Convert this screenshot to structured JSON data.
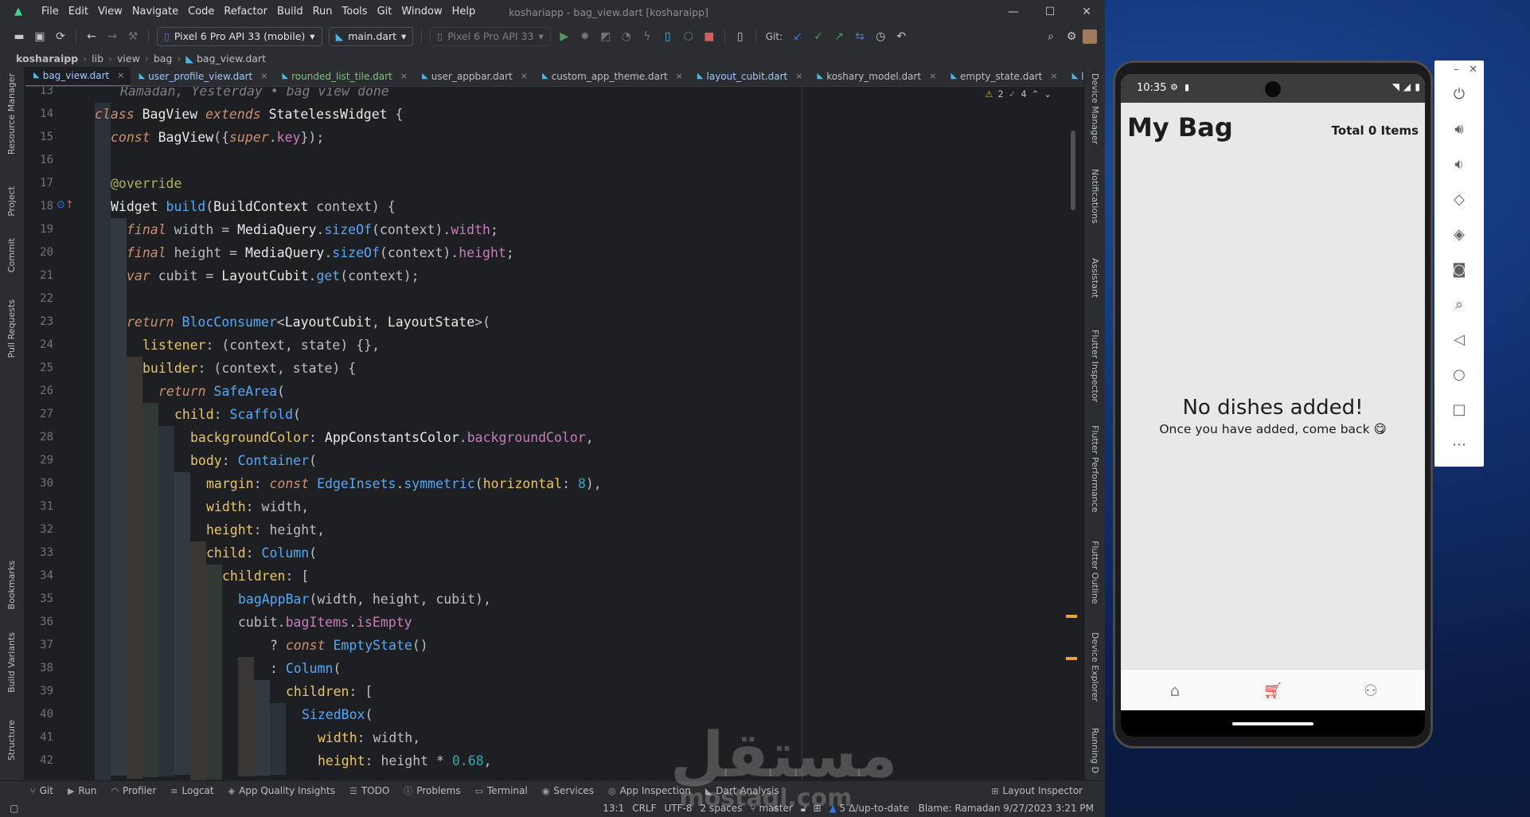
{
  "ide": {
    "menu": [
      "File",
      "Edit",
      "View",
      "Navigate",
      "Code",
      "Refactor",
      "Build",
      "Run",
      "Tools",
      "Git",
      "Window",
      "Help"
    ],
    "window_title": "koshariapp - bag_view.dart [kosharaipp]",
    "device_combo": "Pixel 6 Pro API 33 (mobile)",
    "run_config": "main.dart",
    "emulator_combo": "Pixel 6 Pro API 33",
    "git_label": "Git:",
    "breadcrumb": [
      "kosharaipp",
      "lib",
      "view",
      "bag",
      "bag_view.dart"
    ],
    "tabs": [
      "bag_view.dart",
      "user_profile_view.dart",
      "rounded_list_tile.dart",
      "user_appbar.dart",
      "custom_app_theme.dart",
      "layout_cubit.dart",
      "koshary_model.dart",
      "empty_state.dart",
      "layout_sta"
    ],
    "inspection_warnings": "2",
    "inspection_weak": "4",
    "left_tools": [
      "Resource Manager",
      "Project",
      "Commit",
      "Pull Requests",
      "Bookmarks",
      "Build Variants",
      "Structure"
    ],
    "right_tools": [
      "Device Manager",
      "Notifications",
      "Assistant",
      "Flutter Inspector",
      "Flutter Performance",
      "Flutter Outline",
      "Device Explorer",
      "Running D"
    ],
    "blame_line": "Ramadan, Yesterday • bag view done",
    "line_numbers": [
      "13",
      "14",
      "15",
      "16",
      "17",
      "18",
      "19",
      "20",
      "21",
      "22",
      "23",
      "24",
      "25",
      "26",
      "27",
      "28",
      "29",
      "30",
      "31",
      "32",
      "33",
      "34",
      "35",
      "36",
      "37",
      "38",
      "39",
      "40",
      "41",
      "42"
    ],
    "tool_windows": [
      "Git",
      "Run",
      "Profiler",
      "Logcat",
      "App Quality Insights",
      "TODO",
      "Problems",
      "Terminal",
      "Services",
      "App Inspection",
      "Dart Analysis",
      "Layout Inspector"
    ],
    "status": {
      "position": "13:1",
      "line_sep": "CRLF",
      "encoding": "UTF-8",
      "indent": "2 spaces",
      "branch": "master",
      "vcs_status": "5 Δ/up-to-date",
      "blame": "Blame: Ramadan 9/27/2023 3:21 PM"
    }
  },
  "phone": {
    "time": "10:35",
    "title": "My Bag",
    "total": "Total 0 Items",
    "empty_title": "No dishes added!",
    "empty_subtitle": "Once you have added, come back 😋",
    "nav_icons": [
      "home-icon",
      "cart-icon",
      "person-icon"
    ],
    "accent": "#e53935"
  },
  "emulator_controls": [
    "power-icon",
    "volume-up-icon",
    "volume-down-icon",
    "rotate-left-icon",
    "rotate-right-icon",
    "camera-icon",
    "zoom-icon",
    "back-icon",
    "home-icon",
    "overview-icon",
    "more-icon"
  ],
  "watermark": {
    "arabic": "مستقل",
    "latin": "mostaql.com"
  }
}
